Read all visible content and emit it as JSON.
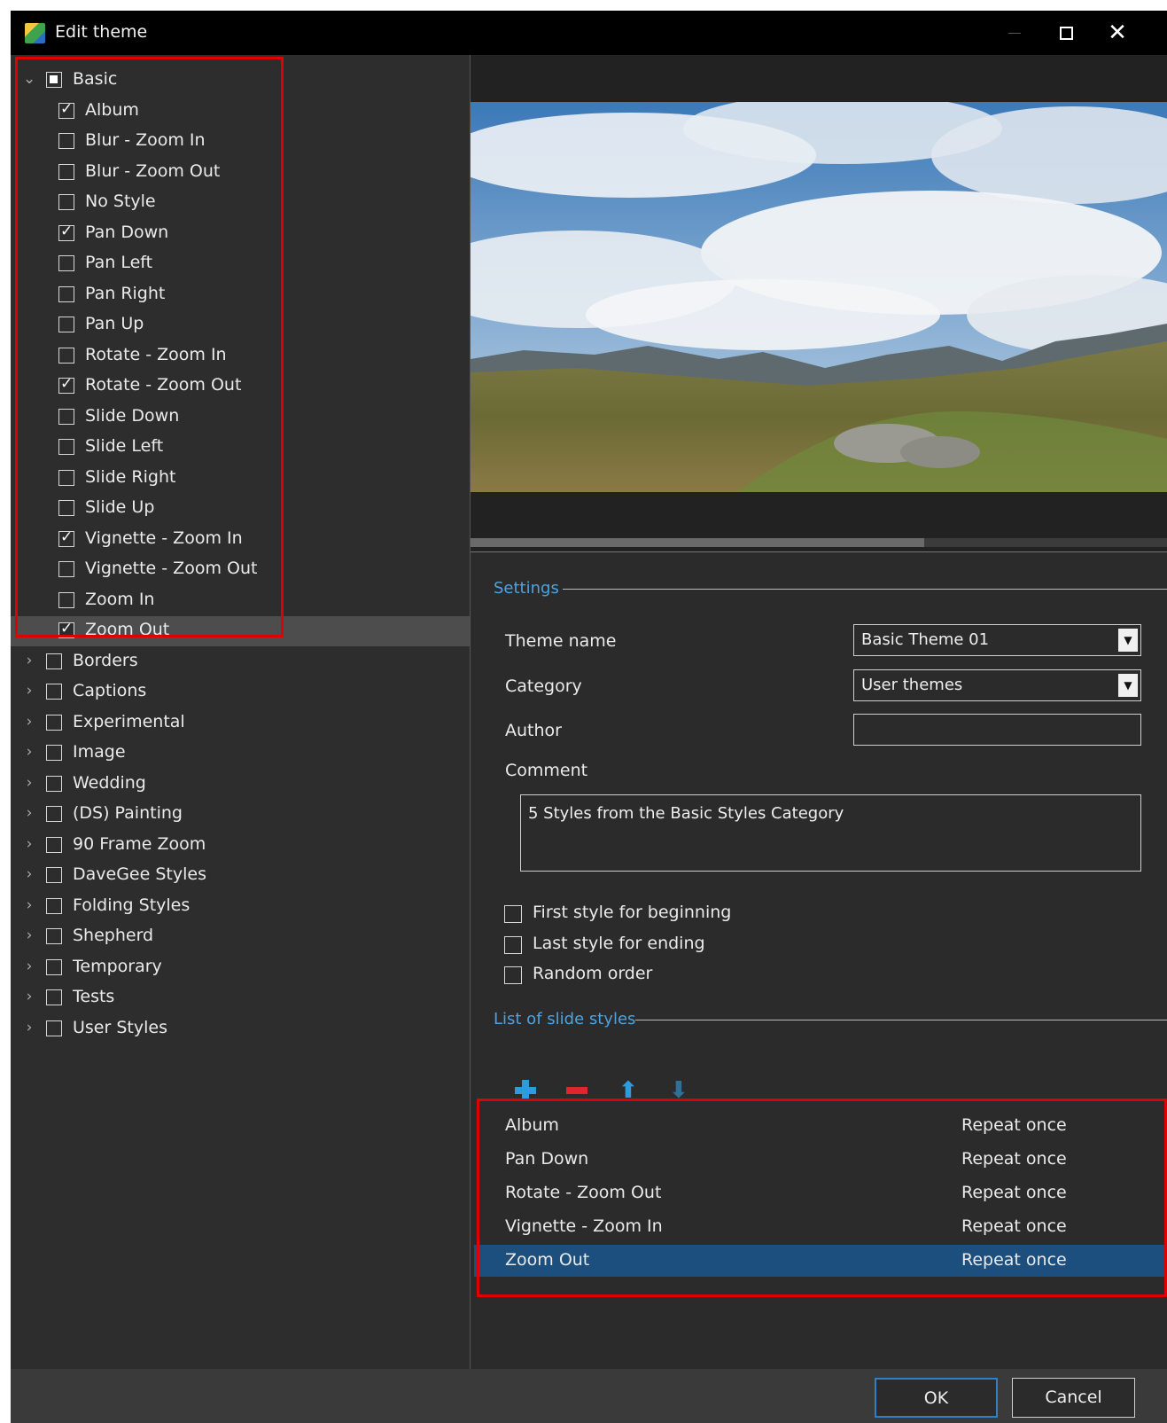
{
  "window": {
    "title": "Edit theme",
    "minimize": "—",
    "maximize": "☐",
    "close": "✕"
  },
  "tree": {
    "root": {
      "label": "Basic",
      "expanded": true,
      "state": "partial"
    },
    "basic_children": [
      {
        "label": "Album",
        "checked": true
      },
      {
        "label": "Blur - Zoom In",
        "checked": false
      },
      {
        "label": "Blur - Zoom Out",
        "checked": false
      },
      {
        "label": "No Style",
        "checked": false
      },
      {
        "label": "Pan Down",
        "checked": true
      },
      {
        "label": "Pan Left",
        "checked": false
      },
      {
        "label": "Pan Right",
        "checked": false
      },
      {
        "label": "Pan Up",
        "checked": false
      },
      {
        "label": "Rotate - Zoom In",
        "checked": false
      },
      {
        "label": "Rotate - Zoom Out",
        "checked": true
      },
      {
        "label": "Slide Down",
        "checked": false
      },
      {
        "label": "Slide Left",
        "checked": false
      },
      {
        "label": "Slide Right",
        "checked": false
      },
      {
        "label": "Slide Up",
        "checked": false
      },
      {
        "label": "Vignette - Zoom In",
        "checked": true
      },
      {
        "label": "Vignette - Zoom Out",
        "checked": false
      },
      {
        "label": "Zoom In",
        "checked": false
      },
      {
        "label": "Zoom Out",
        "checked": true,
        "selected": true
      }
    ],
    "other_categories": [
      "Borders",
      "Captions",
      "Experimental",
      "Image",
      "Wedding",
      "(DS) Painting",
      "90 Frame Zoom",
      "DaveGee Styles",
      "Folding Styles",
      "Shepherd",
      "Temporary",
      "Tests",
      "User Styles"
    ]
  },
  "settings": {
    "section_title": "Settings",
    "theme_name_label": "Theme name",
    "theme_name_value": "Basic Theme 01",
    "category_label": "Category",
    "category_value": "User themes",
    "author_label": "Author",
    "author_value": "",
    "comment_label": "Comment",
    "comment_value": "5 Styles from the Basic Styles Category",
    "options": [
      {
        "label": "First style for beginning",
        "checked": false
      },
      {
        "label": "Last style for ending",
        "checked": false
      },
      {
        "label": "Random order",
        "checked": false
      }
    ]
  },
  "styles_list": {
    "section_title": "List of slide styles",
    "rows": [
      {
        "name": "Album",
        "repeat": "Repeat once"
      },
      {
        "name": "Pan Down",
        "repeat": "Repeat once"
      },
      {
        "name": "Rotate - Zoom Out",
        "repeat": "Repeat once"
      },
      {
        "name": "Vignette - Zoom In",
        "repeat": "Repeat once"
      },
      {
        "name": "Zoom Out",
        "repeat": "Repeat once",
        "selected": true
      }
    ]
  },
  "buttons": {
    "ok": "OK",
    "cancel": "Cancel"
  },
  "colors": {
    "accent": "#4ea3dd",
    "highlight": "#e00000",
    "selection": "#1c4e7e"
  }
}
